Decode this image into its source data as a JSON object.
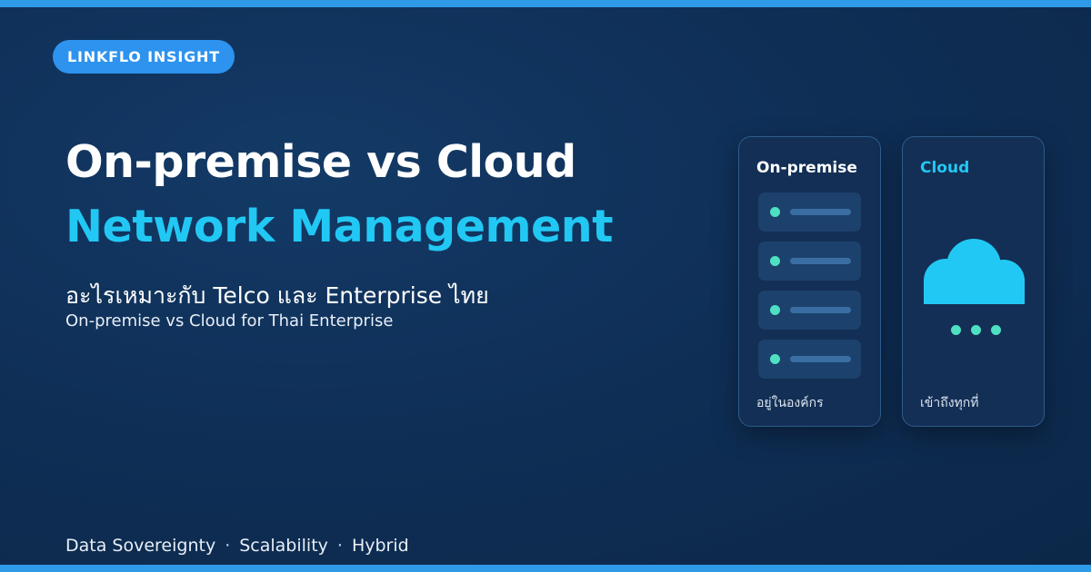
{
  "badge": "LINKFLO INSIGHT",
  "headline": {
    "line1": "On-premise vs Cloud",
    "line2": "Network Management"
  },
  "subtitle_th": "อะไรเหมาะกับ Telco และ Enterprise ไทย",
  "subtitle_en": "On-premise vs Cloud for Thai Enterprise",
  "tags": [
    "Data Sovereignty",
    "Scalability",
    "Hybrid"
  ],
  "tag_separator": "·",
  "cards": {
    "onprem": {
      "title": "On-premise",
      "caption": "อยู่ในองค์กร",
      "icon": "server-rack-icon"
    },
    "cloud": {
      "title": "Cloud",
      "caption": "เข้าถึงทุกที่",
      "icon": "cloud-icon"
    }
  },
  "colors": {
    "background": "#0f2f57",
    "accent_bar": "#2f9ae8",
    "badge": "#2d93ef",
    "headline_accent": "#22c8f4",
    "status_dot": "#4fe0c3"
  }
}
